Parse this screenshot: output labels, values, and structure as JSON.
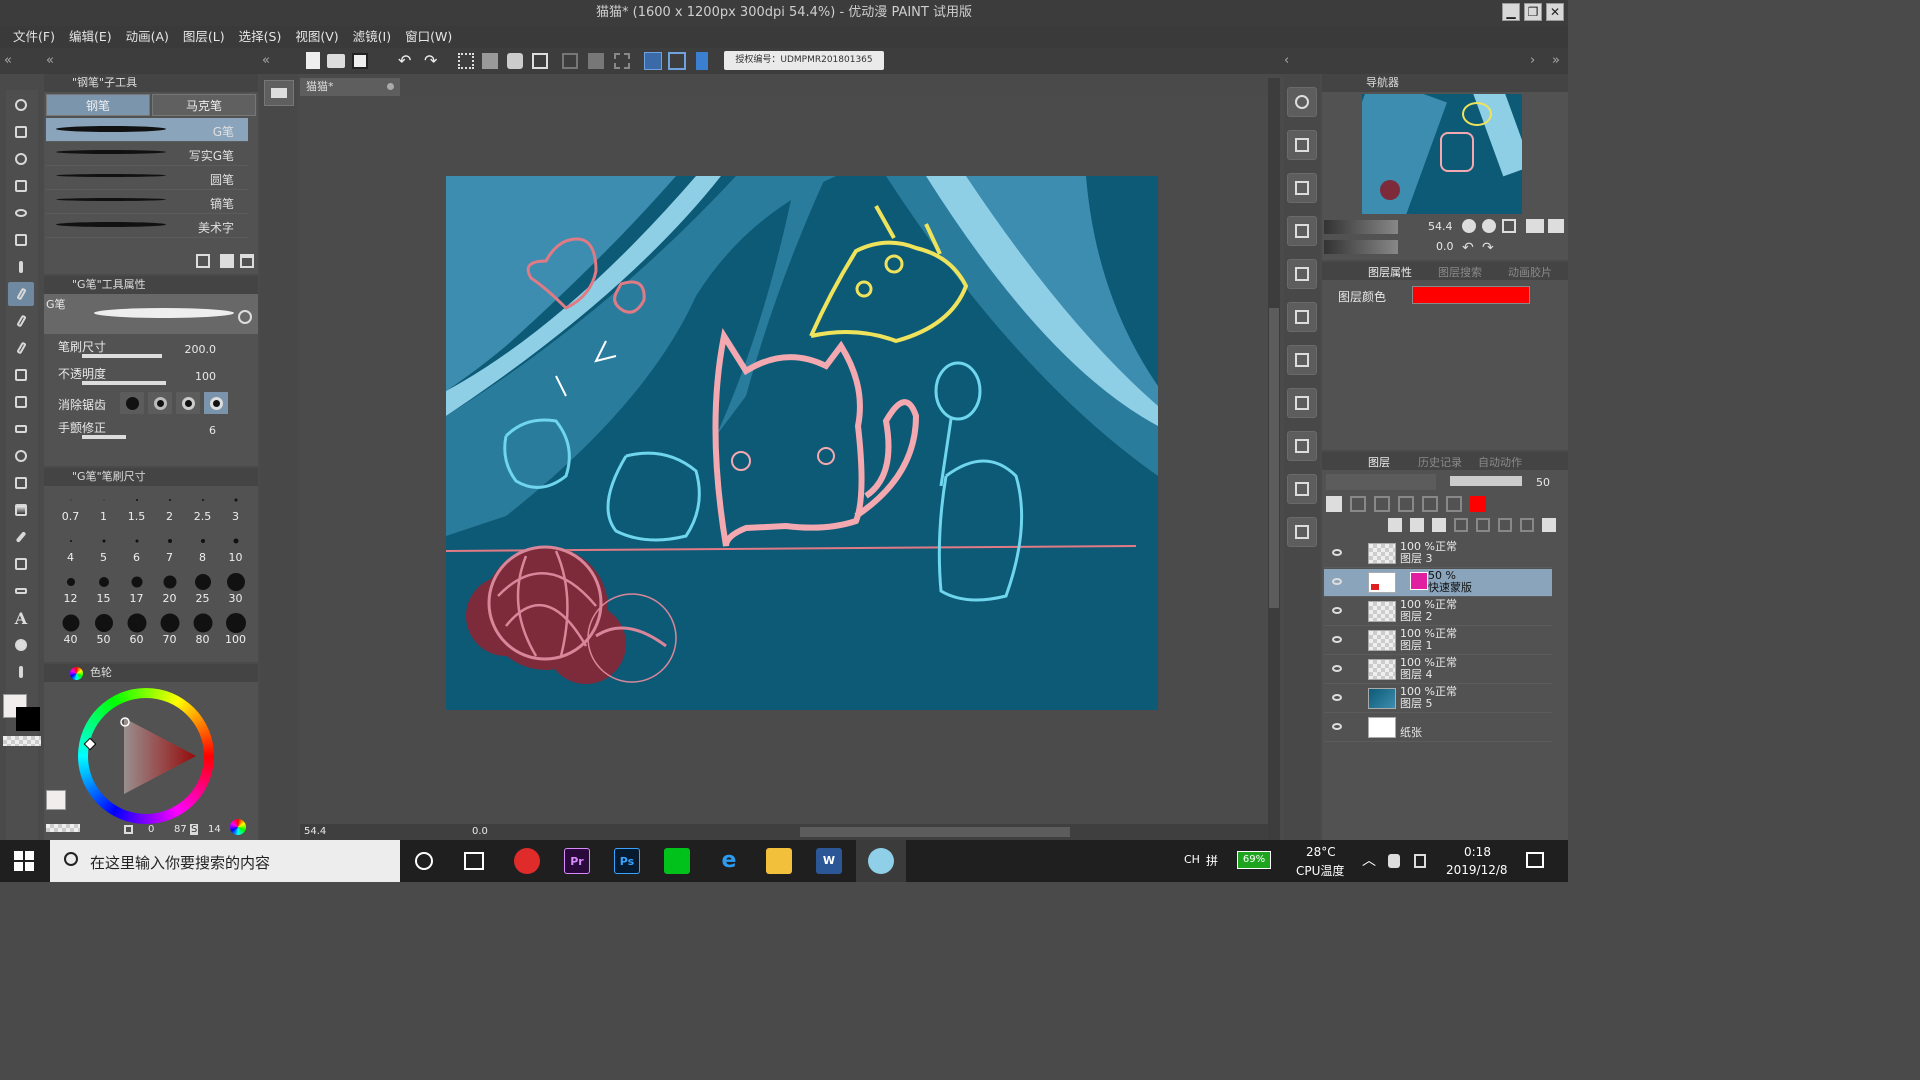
{
  "window": {
    "title": "猫猫* (1600 x 1200px 300dpi 54.4%)  - 优动漫 PAINT 试用版",
    "controls": [
      "▁",
      "❐",
      "✕"
    ]
  },
  "menu": [
    "文件(F)",
    "编辑(E)",
    "动画(A)",
    "图层(L)",
    "选择(S)",
    "视图(V)",
    "滤镜(I)",
    "窗口(W)"
  ],
  "toolbar": {
    "license_label": "授权编号：UDMPMR201801365"
  },
  "subtool_panel": {
    "header": "\"钢笔\"子工具",
    "tabs": [
      "钢笔",
      "马克笔"
    ],
    "brushes": [
      "G笔",
      "写实G笔",
      "圆笔",
      "镝笔",
      "美术字"
    ]
  },
  "tool_property": {
    "header": "\"G笔\"工具属性",
    "preview_label": "G笔",
    "brush_size_label": "笔刷尺寸",
    "brush_size_value": "200.0",
    "opacity_label": "不透明度",
    "opacity_value": "100",
    "antialias_label": "消除锯齿",
    "stabilization_label": "手颤修正",
    "stabilization_value": "6"
  },
  "brush_size_panel": {
    "header": "\"G笔\"笔刷尺寸",
    "sizes": [
      "0.7",
      "1",
      "1.5",
      "2",
      "2.5",
      "3",
      "4",
      "5",
      "6",
      "7",
      "8",
      "10",
      "12",
      "15",
      "17",
      "20",
      "25",
      "30",
      "40",
      "50",
      "60",
      "70",
      "80",
      "100"
    ],
    "dot_diameters": [
      1,
      1,
      2,
      2,
      2,
      3,
      2,
      3,
      3,
      4,
      4,
      5,
      8,
      10,
      11,
      13,
      16,
      18,
      17,
      18,
      19,
      19,
      19,
      20
    ]
  },
  "color_panel": {
    "tab": "色轮",
    "h_value": "0",
    "s_label": "S",
    "s_value": "87",
    "v_value": "14"
  },
  "document": {
    "tab": "猫猫*",
    "zoom": "54.4",
    "rotation": "0.0"
  },
  "navigator": {
    "tab": "导航器",
    "zoom": "54.4",
    "rotation": "0.0"
  },
  "layer_property": {
    "tabs": [
      "图层属性",
      "图层搜索",
      "动画胶片"
    ],
    "color_label": "图层颜色",
    "layer_color": "#ff0000"
  },
  "layers_panel": {
    "tabs": [
      "图层",
      "历史记录",
      "自动动作"
    ],
    "opacity_value": "50",
    "layers": [
      {
        "mode": "100 %正常",
        "name": "图层 3",
        "thumb": "checker"
      },
      {
        "mode": "50 %",
        "name": "快速蒙版",
        "thumb": "mask",
        "selected": true
      },
      {
        "mode": "100 %正常",
        "name": "图层 2",
        "thumb": "checker"
      },
      {
        "mode": "100 %正常",
        "name": "图层 1",
        "thumb": "checker"
      },
      {
        "mode": "100 %正常",
        "name": "图层 4",
        "thumb": "checker"
      },
      {
        "mode": "100 %正常",
        "name": "图层 5",
        "thumb": "teal"
      },
      {
        "mode": "",
        "name": "纸张",
        "thumb": "white"
      }
    ]
  },
  "taskbar": {
    "search_placeholder": "在这里输入你要搜索的内容",
    "apps": [
      "网易云音乐",
      "Pr",
      "Ps",
      "爱奇艺",
      "Edge",
      "文件资源管理器",
      "W",
      "优动漫"
    ],
    "lang": "CH",
    "ime": "拼",
    "battery": "69%",
    "temp": "28°C",
    "temp_label": "CPU温度",
    "time": "0:18",
    "date": "2019/12/8"
  },
  "colors": {
    "canvas_bg": "#0d5a76",
    "accent_selection": "#8aa4bc",
    "layer_red": "#ff0000"
  }
}
